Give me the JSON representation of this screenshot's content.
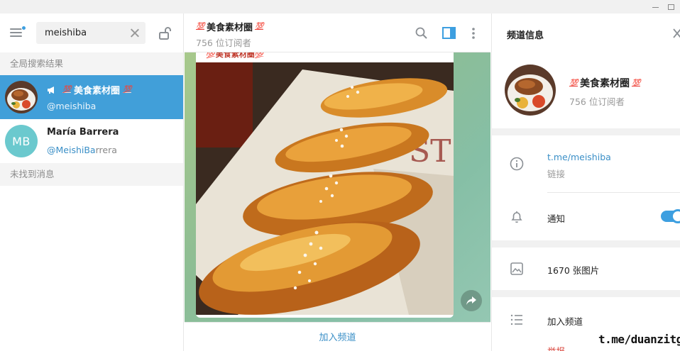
{
  "window": {
    "min_label": "",
    "max_label": ""
  },
  "search": {
    "value": "meishiba",
    "placeholder": ""
  },
  "left": {
    "global_results_header": "全局搜索结果",
    "results": [
      {
        "title": "美食素材圈",
        "emoji": "💯",
        "subtitle": "@meishiba",
        "type": "channel"
      },
      {
        "title": "María Barrera",
        "initials": "MB",
        "subtitle_match": "@MeishiBa",
        "subtitle_rest": "rrera",
        "avatar_color": "#6bc9ce"
      }
    ],
    "no_messages_header": "未找到消息"
  },
  "chat": {
    "title": "美食素材圈",
    "emoji": "💯",
    "subscribers": "756 位订阅者",
    "bubble_caption": "💯美食素材圈💯",
    "join_label": "加入频道"
  },
  "info": {
    "header": "频道信息",
    "name": "美食素材圈",
    "emoji": "💯",
    "subscribers": "756 位订阅者",
    "link": "t.me/meishiba",
    "link_label": "链接",
    "notifications_label": "通知",
    "notifications_on": true,
    "photos": "1670 张图片",
    "join": "加入频道",
    "leave_partial": "举报"
  },
  "watermark": "t.me/duanzitg",
  "colors": {
    "accent": "#419fd9",
    "link": "#3a8fc7",
    "badge_dot": "#3d9fe0"
  },
  "icons": [
    "menu-icon",
    "clear-icon",
    "lock-icon",
    "megaphone-icon",
    "search-icon",
    "panel-icon",
    "more-icon",
    "close-icon",
    "info-icon",
    "bell-icon",
    "image-icon",
    "list-icon",
    "share-icon"
  ]
}
